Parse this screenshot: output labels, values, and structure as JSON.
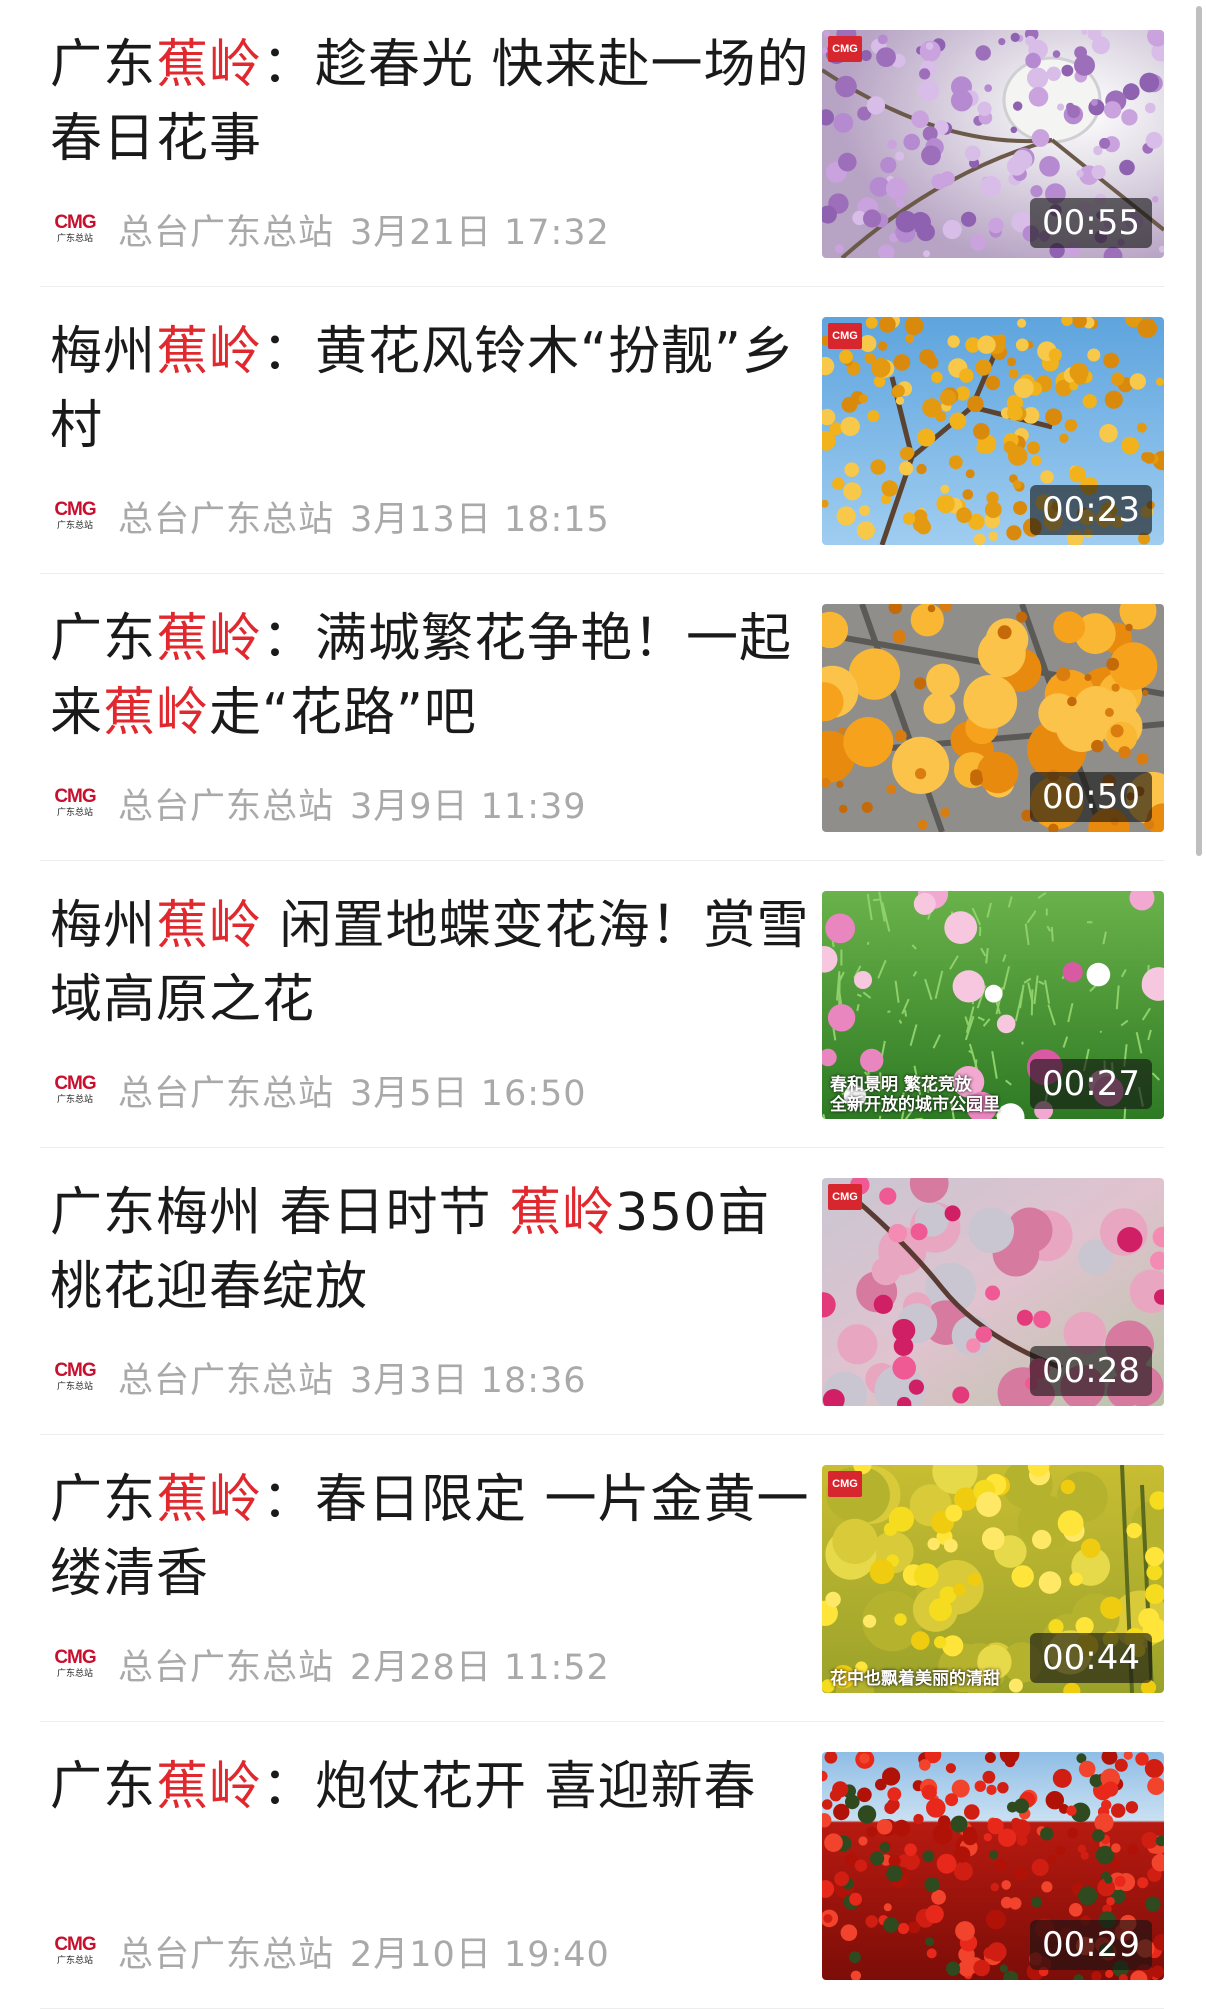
{
  "items": [
    {
      "title_parts": [
        {
          "text": "广东",
          "hl": false
        },
        {
          "text": "蕉岭",
          "hl": true
        },
        {
          "text": "：趁春光 快来赴一场的春日花事",
          "hl": false
        }
      ],
      "logo": "CMG",
      "logo_sub": "广东总站",
      "source": "总台广东总站",
      "date": "3月21日 17:32",
      "duration": "00:55",
      "thumb": "purple-blossom",
      "caption_lines": [],
      "thumb_logo": true
    },
    {
      "title_parts": [
        {
          "text": "梅州",
          "hl": false
        },
        {
          "text": "蕉岭",
          "hl": true
        },
        {
          "text": "：黄花风铃木“扮靓”乡村",
          "hl": false
        }
      ],
      "logo": "CMG",
      "logo_sub": "广东总站",
      "source": "总台广东总站",
      "date": "3月13日 18:15",
      "duration": "00:23",
      "thumb": "yellow-tree",
      "caption_lines": [],
      "thumb_logo": true
    },
    {
      "title_parts": [
        {
          "text": "广东",
          "hl": false
        },
        {
          "text": "蕉岭",
          "hl": true
        },
        {
          "text": "：满城繁花争艳！一起来",
          "hl": false
        },
        {
          "text": "蕉岭",
          "hl": true
        },
        {
          "text": "走“花路”吧",
          "hl": false
        }
      ],
      "logo": "CMG",
      "logo_sub": "广东总站",
      "source": "总台广东总站",
      "date": "3月9日 11:39",
      "duration": "00:50",
      "thumb": "orange-flowers",
      "caption_lines": [],
      "thumb_logo": false
    },
    {
      "title_parts": [
        {
          "text": "梅州",
          "hl": false
        },
        {
          "text": "蕉岭",
          "hl": true
        },
        {
          "text": " 闲置地蝶变花海！赏雪域高原之花",
          "hl": false
        }
      ],
      "logo": "CMG",
      "logo_sub": "广东总站",
      "source": "总台广东总站",
      "date": "3月5日 16:50",
      "duration": "00:27",
      "thumb": "cosmos",
      "caption_lines": [
        "春和景明 繁花竞放",
        "全新开放的城市公园里"
      ],
      "thumb_logo": false
    },
    {
      "title_parts": [
        {
          "text": "广东梅州 春日时节 ",
          "hl": false
        },
        {
          "text": "蕉岭",
          "hl": true
        },
        {
          "text": "350亩桃花迎春绽放",
          "hl": false
        }
      ],
      "logo": "CMG",
      "logo_sub": "广东总站",
      "source": "总台广东总站",
      "date": "3月3日 18:36",
      "duration": "00:28",
      "thumb": "peach",
      "caption_lines": [],
      "thumb_logo": true
    },
    {
      "title_parts": [
        {
          "text": "广东",
          "hl": false
        },
        {
          "text": "蕉岭",
          "hl": true
        },
        {
          "text": "：春日限定 一片金黄一缕清香",
          "hl": false
        }
      ],
      "logo": "CMG",
      "logo_sub": "广东总站",
      "source": "总台广东总站",
      "date": "2月28日 11:52",
      "duration": "00:44",
      "thumb": "rapeseed",
      "caption_lines": [
        "花中也飘着美丽的清甜"
      ],
      "thumb_logo": true
    },
    {
      "title_parts": [
        {
          "text": "广东",
          "hl": false
        },
        {
          "text": "蕉岭",
          "hl": true
        },
        {
          "text": "：炮仗花开 喜迎新春",
          "hl": false
        }
      ],
      "logo": "CMG",
      "logo_sub": "广东总站",
      "source": "总台广东总站",
      "date": "2月10日 19:40",
      "duration": "00:29",
      "thumb": "red-vine",
      "caption_lines": [],
      "thumb_logo": false
    }
  ],
  "colors": {
    "highlight": "#e0282e",
    "title": "#1a1a1a",
    "meta": "#a9a9a9",
    "logo_red": "#c8102e"
  }
}
